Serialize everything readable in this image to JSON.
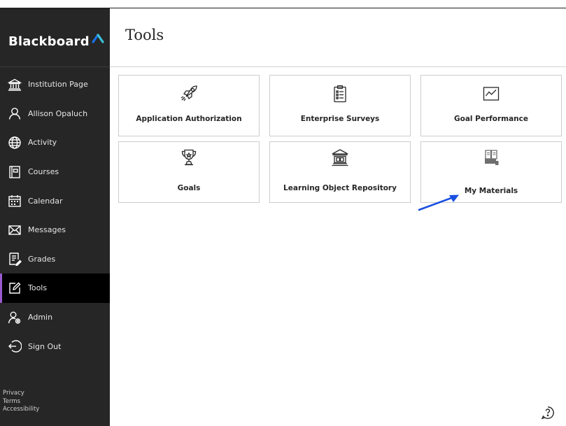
{
  "brand": {
    "logo_text": "Blackboard",
    "accent_color": "#1a73e8",
    "active_indicator_color": "#9b59d0"
  },
  "sidebar": {
    "items": [
      {
        "label": "Institution Page",
        "icon": "institution-icon"
      },
      {
        "label": "Allison Opaluch",
        "icon": "user-icon"
      },
      {
        "label": "Activity",
        "icon": "globe-icon"
      },
      {
        "label": "Courses",
        "icon": "courses-icon"
      },
      {
        "label": "Calendar",
        "icon": "calendar-icon"
      },
      {
        "label": "Messages",
        "icon": "envelope-icon"
      },
      {
        "label": "Grades",
        "icon": "grades-icon"
      },
      {
        "label": "Tools",
        "icon": "tools-icon",
        "active": true
      },
      {
        "label": "Admin",
        "icon": "admin-icon"
      },
      {
        "label": "Sign Out",
        "icon": "sign-out-icon"
      }
    ],
    "footer": {
      "privacy": "Privacy",
      "terms": "Terms",
      "accessibility": "Accessibility"
    }
  },
  "main": {
    "title": "Tools",
    "tiles": [
      {
        "label": "Application Authorization",
        "icon": "rocket-icon"
      },
      {
        "label": "Enterprise Surveys",
        "icon": "clipboard-icon"
      },
      {
        "label": "Goal Performance",
        "icon": "line-chart-icon"
      },
      {
        "label": "Goals",
        "icon": "trophy-icon"
      },
      {
        "label": "Learning Object Repository",
        "icon": "repository-building-icon"
      },
      {
        "label": "My Materials",
        "icon": "materials-book-icon"
      }
    ]
  },
  "annotation": {
    "arrow_color": "#1a4fe0",
    "points_to": "My Materials"
  },
  "help": {
    "icon": "help-icon"
  }
}
